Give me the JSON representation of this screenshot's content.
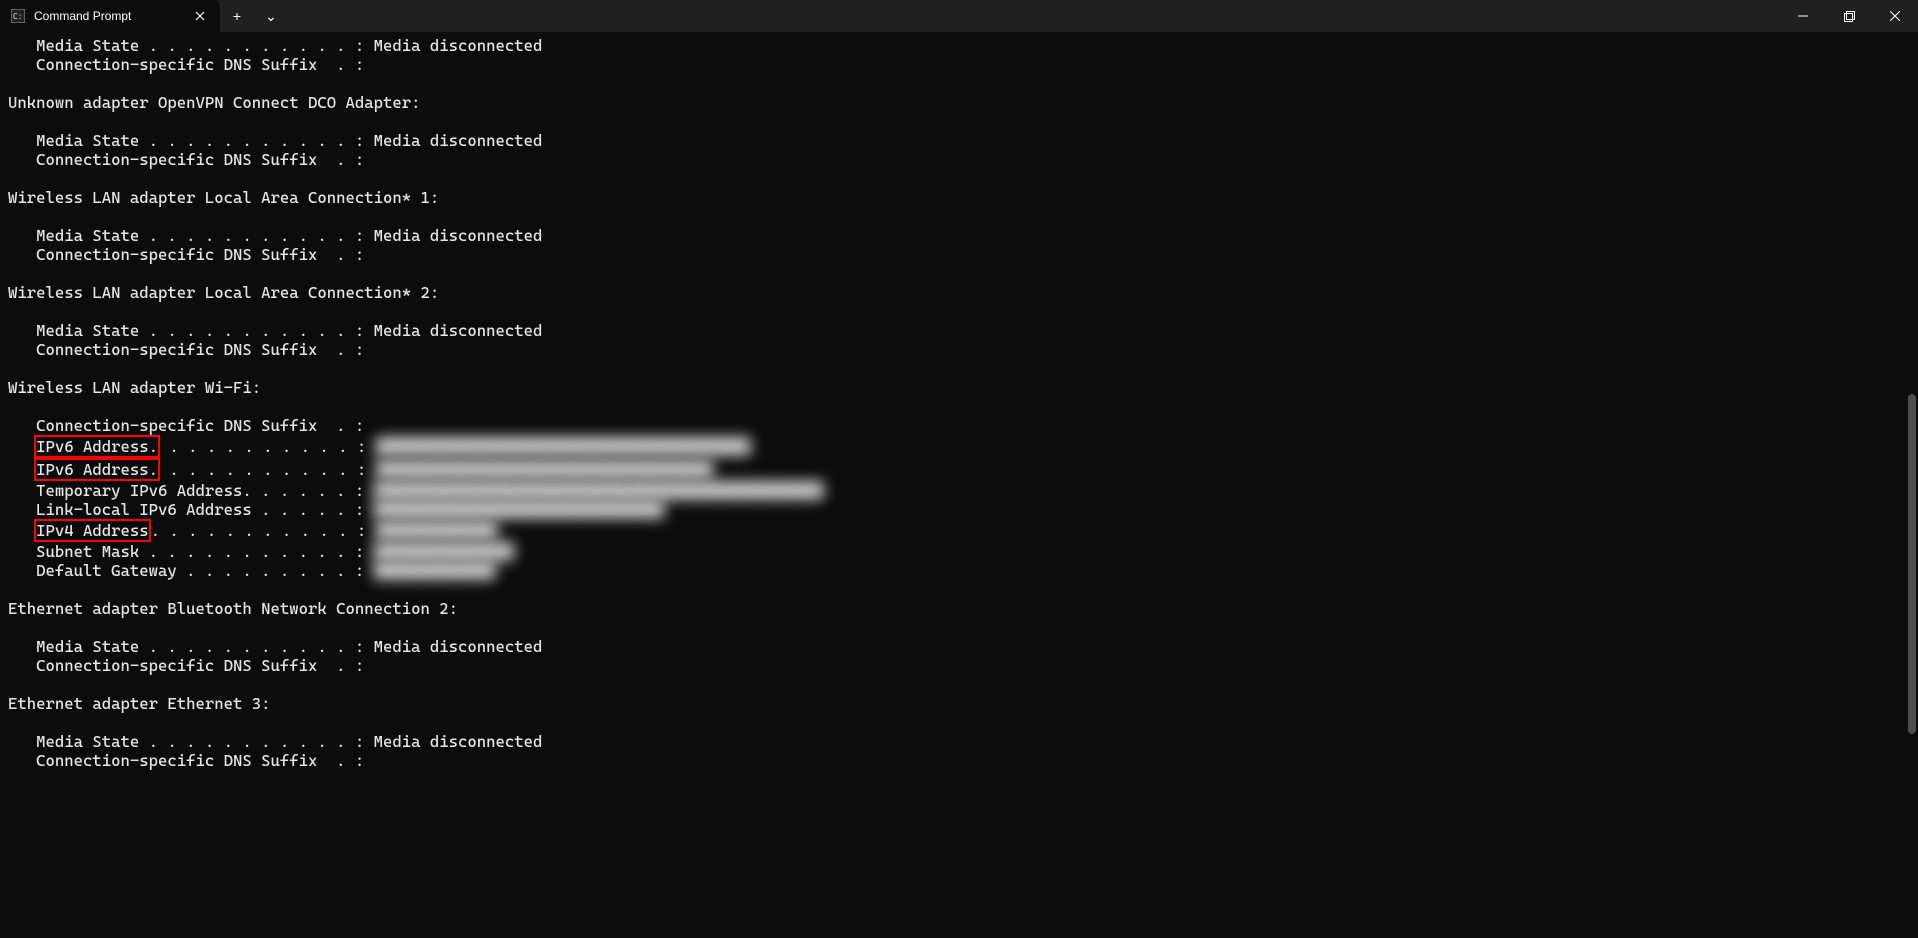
{
  "window": {
    "tab_title": "Command Prompt",
    "new_tab_label": "+",
    "dropdown_label": "⌄"
  },
  "output": {
    "l1": "   Media State . . . . . . . . . . . : Media disconnected",
    "l2": "   Connection-specific DNS Suffix  . :",
    "l3": "Unknown adapter OpenVPN Connect DCO Adapter:",
    "l4": "   Media State . . . . . . . . . . . : Media disconnected",
    "l5": "   Connection-specific DNS Suffix  . :",
    "l6": "Wireless LAN adapter Local Area Connection* 1:",
    "l7": "   Media State . . . . . . . . . . . : Media disconnected",
    "l8": "   Connection-specific DNS Suffix  . :",
    "l9": "Wireless LAN adapter Local Area Connection* 2:",
    "l10": "   Media State . . . . . . . . . . . : Media disconnected",
    "l11": "   Connection-specific DNS Suffix  . :",
    "l12": "Wireless LAN adapter Wi-Fi:",
    "l13": "   Connection-specific DNS Suffix  . :",
    "wifi_ipv6_a_label": "IPv6 Address.",
    "wifi_ipv6_a_dots": " . . . . . . . . . . : ",
    "wifi_ipv6_a_val": "████████████████████████████████████████",
    "wifi_ipv6_b_label": "IPv6 Address.",
    "wifi_ipv6_b_dots": " . . . . . . . . . . : ",
    "wifi_ipv6_b_val": "████████████████████████████████████",
    "wifi_temp_ipv6": "   Temporary IPv6 Address. . . . . . : ",
    "wifi_temp_ipv6_val": "████████████████████████████████████████████████",
    "wifi_linklocal": "   Link-local IPv6 Address . . . . . : ",
    "wifi_linklocal_val": "███████████████████████████████",
    "wifi_ipv4_label": "IPv4 Address",
    "wifi_ipv4_dots": ". . . . . . . . . . . : ",
    "wifi_ipv4_val": "█████████████",
    "wifi_subnet": "   Subnet Mask . . . . . . . . . . . : ",
    "wifi_subnet_val": "███████████████",
    "wifi_gateway": "   Default Gateway . . . . . . . . . : ",
    "wifi_gateway_val": "█████████████",
    "l14": "Ethernet adapter Bluetooth Network Connection 2:",
    "l15": "   Media State . . . . . . . . . . . : Media disconnected",
    "l16": "   Connection-specific DNS Suffix  . :",
    "l17": "Ethernet adapter Ethernet 3:",
    "l18": "   Media State . . . . . . . . . . . : Media disconnected",
    "l19": "   Connection-specific DNS Suffix  . :"
  }
}
